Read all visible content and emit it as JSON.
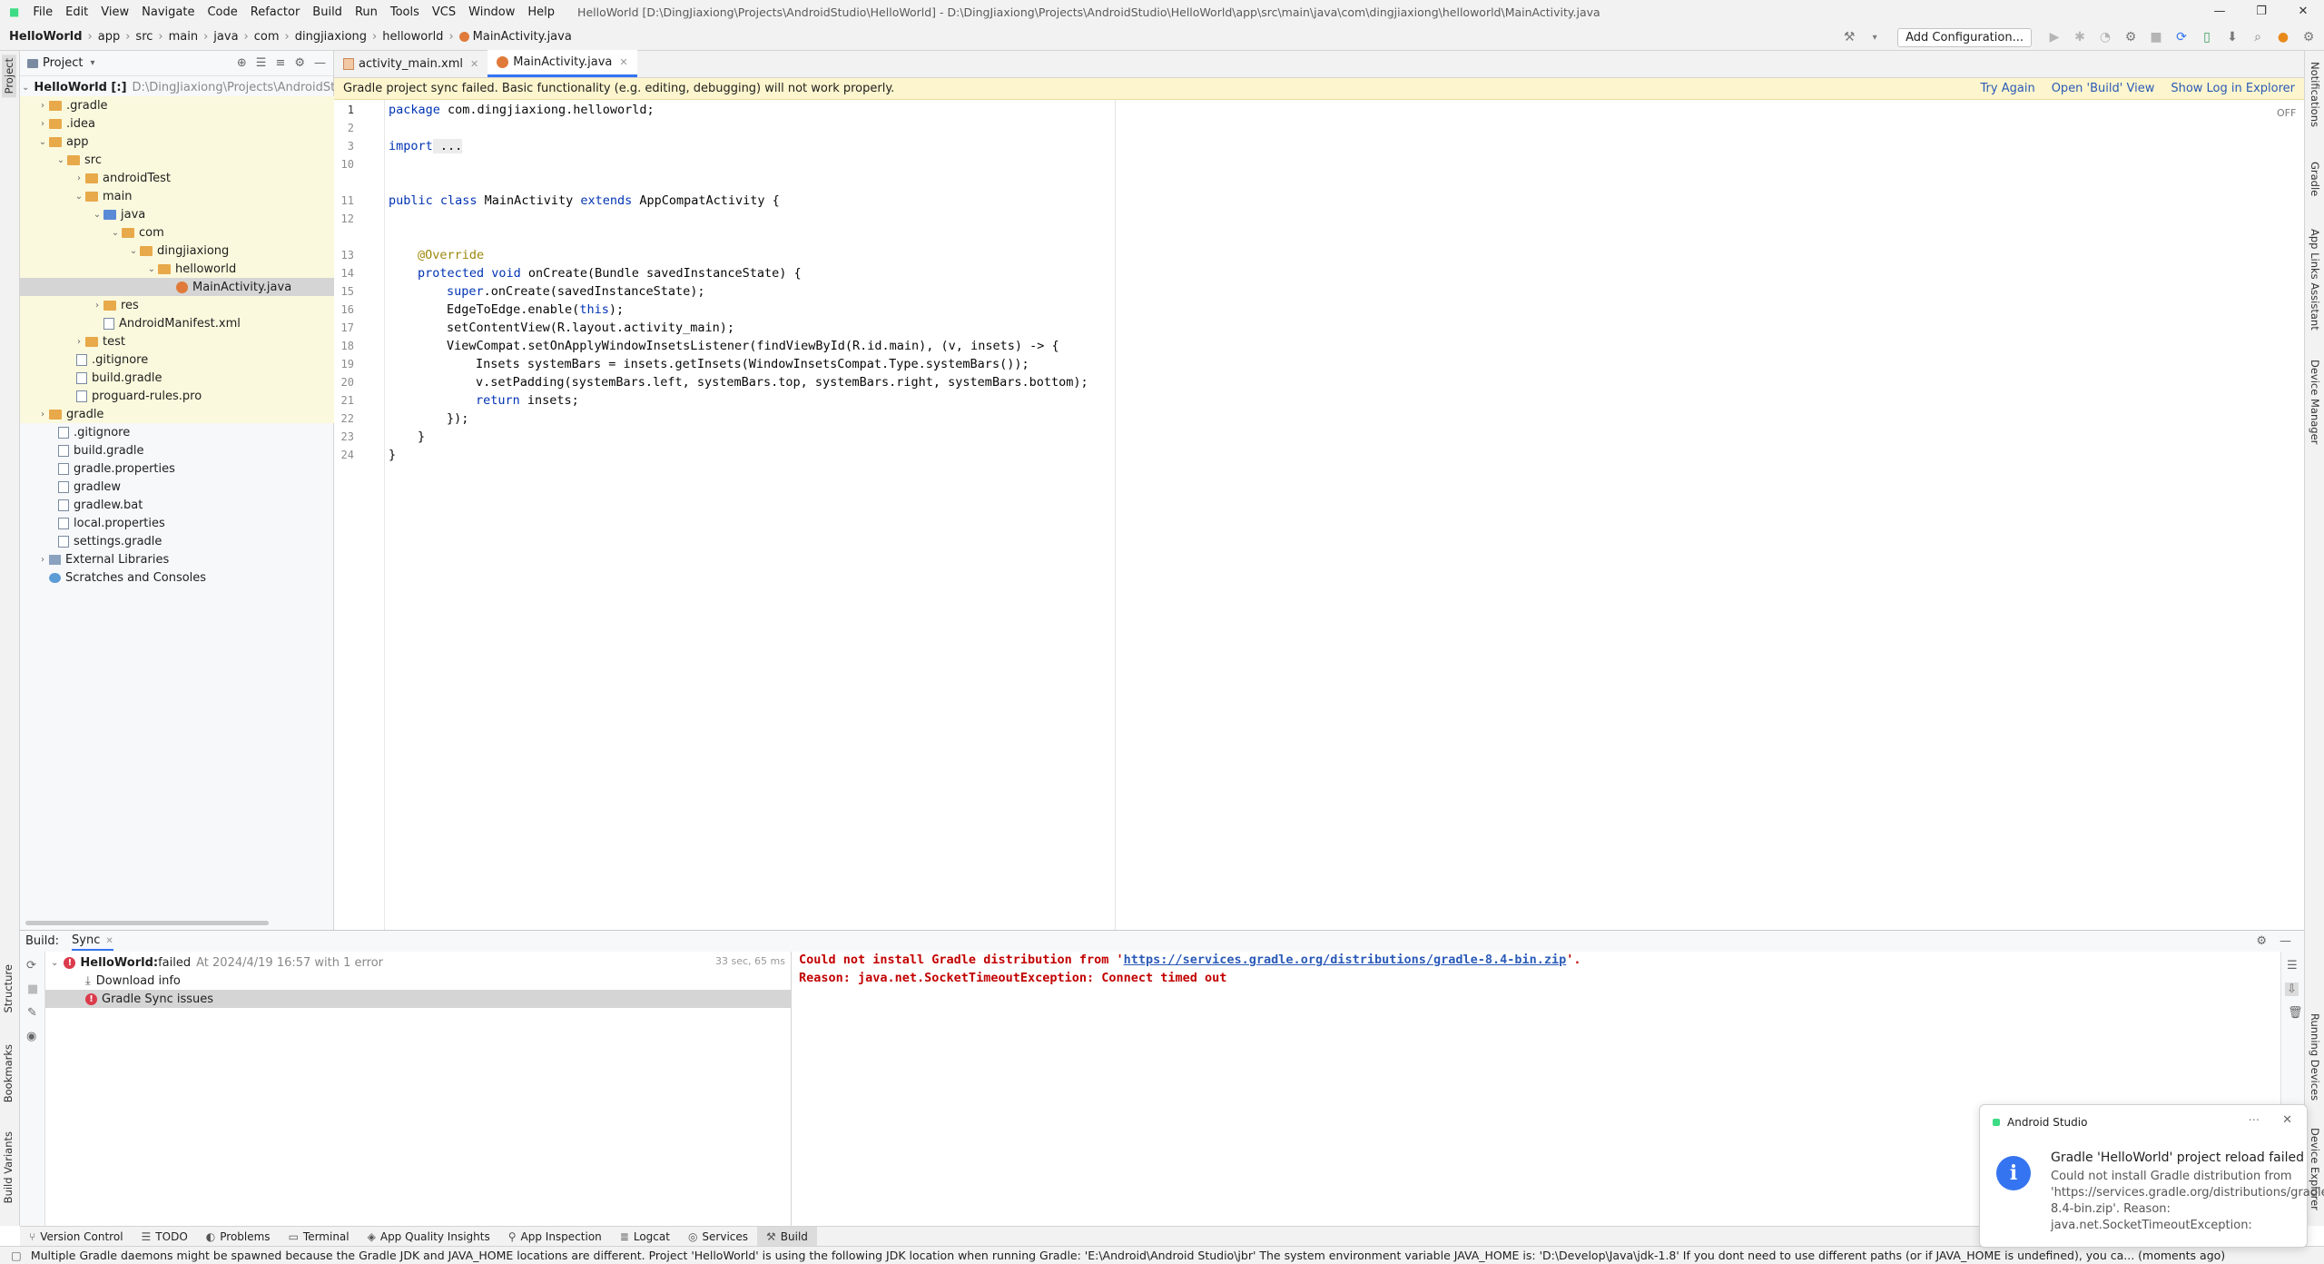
{
  "menu": [
    "File",
    "Edit",
    "View",
    "Navigate",
    "Code",
    "Refactor",
    "Build",
    "Run",
    "Tools",
    "VCS",
    "Window",
    "Help"
  ],
  "window_title": "HelloWorld [D:\\DingJiaxiong\\Projects\\AndroidStudio\\HelloWorld] - D:\\DingJiaxiong\\Projects\\AndroidStudio\\HelloWorld\\app\\src\\main\\java\\com\\dingjiaxiong\\helloworld\\MainActivity.java",
  "breadcrumb": [
    "HelloWorld",
    "app",
    "src",
    "main",
    "java",
    "com",
    "dingjiaxiong",
    "helloworld",
    "MainActivity.java"
  ],
  "toolbar": {
    "add_config": "Add Configuration..."
  },
  "left_strip": [
    "Project",
    "Structure",
    "Bookmarks",
    "Build Variants"
  ],
  "right_strip": [
    "Notifications",
    "Gradle",
    "App Links Assistant",
    "Device Manager",
    "Running Devices",
    "Device Explorer"
  ],
  "project": {
    "header": "Project",
    "items": [
      {
        "label": "HelloWorld [:]",
        "extra": "D:\\DingJiaxiong\\Projects\\AndroidStu",
        "bold": true
      },
      {
        "label": ".gradle"
      },
      {
        "label": ".idea"
      },
      {
        "label": "app"
      },
      {
        "label": "src"
      },
      {
        "label": "androidTest"
      },
      {
        "label": "main"
      },
      {
        "label": "java"
      },
      {
        "label": "com"
      },
      {
        "label": "dingjiaxiong"
      },
      {
        "label": "helloworld"
      },
      {
        "label": "MainActivity.java"
      },
      {
        "label": "res"
      },
      {
        "label": "AndroidManifest.xml"
      },
      {
        "label": "test"
      },
      {
        "label": ".gitignore"
      },
      {
        "label": "build.gradle"
      },
      {
        "label": "proguard-rules.pro"
      },
      {
        "label": "gradle"
      },
      {
        "label": ".gitignore"
      },
      {
        "label": "build.gradle"
      },
      {
        "label": "gradle.properties"
      },
      {
        "label": "gradlew"
      },
      {
        "label": "gradlew.bat"
      },
      {
        "label": "local.properties"
      },
      {
        "label": "settings.gradle"
      },
      {
        "label": "External Libraries"
      },
      {
        "label": "Scratches and Consoles"
      }
    ]
  },
  "editor": {
    "tabs": [
      "activity_main.xml",
      "MainActivity.java"
    ],
    "banner": "Gradle project sync failed. Basic functionality (e.g. editing, debugging) will not work properly.",
    "banner_actions": [
      "Try Again",
      "Open 'Build' View",
      "Show Log in Explorer"
    ],
    "off_label": "OFF",
    "line_numbers": [
      "1",
      "2",
      "3",
      "10",
      "11",
      "12",
      "13",
      "14",
      "15",
      "16",
      "17",
      "18",
      "19",
      "20",
      "21",
      "22",
      "23",
      "24"
    ],
    "lines": [
      [
        "package",
        " com.dingjiaxiong.helloworld;"
      ],
      [
        "",
        ""
      ],
      [
        "import",
        " ..."
      ],
      [
        "",
        ""
      ],
      [
        "public class",
        " MainActivity ",
        "extends",
        " AppCompatActivity {"
      ],
      [
        "",
        ""
      ],
      [
        "@Override",
        ""
      ],
      [
        "protected void",
        " onCreate(Bundle savedInstanceState) {"
      ],
      [
        "super",
        ".onCreate(savedInstanceState);"
      ],
      [
        "",
        "EdgeToEdge.enable(",
        "this",
        ");"
      ],
      [
        "",
        "setContentView(R.layout.activity_main);"
      ],
      [
        "",
        "ViewCompat.setOnApplyWindowInsetsListener(findViewById(R.id.main), (v, insets) -> {"
      ],
      [
        "",
        "Insets systemBars = insets.getInsets(WindowInsetsCompat.Type.systemBars());"
      ],
      [
        "",
        "v.setPadding(systemBars.left, systemBars.top, systemBars.right, systemBars.bottom);"
      ],
      [
        "return",
        " insets;"
      ],
      [
        "",
        "});"
      ],
      [
        "",
        "}"
      ],
      [
        "",
        "}"
      ]
    ]
  },
  "build": {
    "label": "Build:",
    "tab": "Sync",
    "root": {
      "name": "HelloWorld:",
      "status": " failed",
      "detail": "At 2024/4/19 16:57 with 1 error",
      "time": "33 sec, 65 ms"
    },
    "children": [
      "Download info",
      "Gradle Sync issues"
    ],
    "output": [
      {
        "pre": "Could not install Gradle distribution from '",
        "link": "https://services.gradle.org/distributions/gradle-8.4-bin.zip",
        "post": "'."
      },
      {
        "pre": "Reason: java.net.SocketTimeoutException: Connect timed out",
        "link": "",
        "post": ""
      }
    ]
  },
  "bottom_tabs": [
    "Version Control",
    "TODO",
    "Problems",
    "Terminal",
    "App Quality Insights",
    "App Inspection",
    "Logcat",
    "Services",
    "Build"
  ],
  "status": "Multiple Gradle daemons might be spawned because the Gradle JDK and JAVA_HOME locations are different. Project 'HelloWorld' is using the following JDK location when running Gradle: 'E:\\Android\\Android Studio\\jbr' The system environment variable JAVA_HOME is: 'D:\\Develop\\Java\\jdk-1.8' If you dont need to use different paths (or if JAVA_HOME is undefined), you ca... (moments ago)",
  "notification": {
    "source": "Android Studio",
    "title": "Gradle 'HelloWorld' project reload failed",
    "body": "Could not install Gradle distribution from 'https://services.gradle.org/distributions/gradle-8.4-bin.zip'. Reason: java.net.SocketTimeoutException:"
  },
  "colors": {
    "accent": "#3574f0",
    "error": "#db3b4b",
    "banner": "#fdf5cd",
    "highlight": "#fbf9dd"
  }
}
